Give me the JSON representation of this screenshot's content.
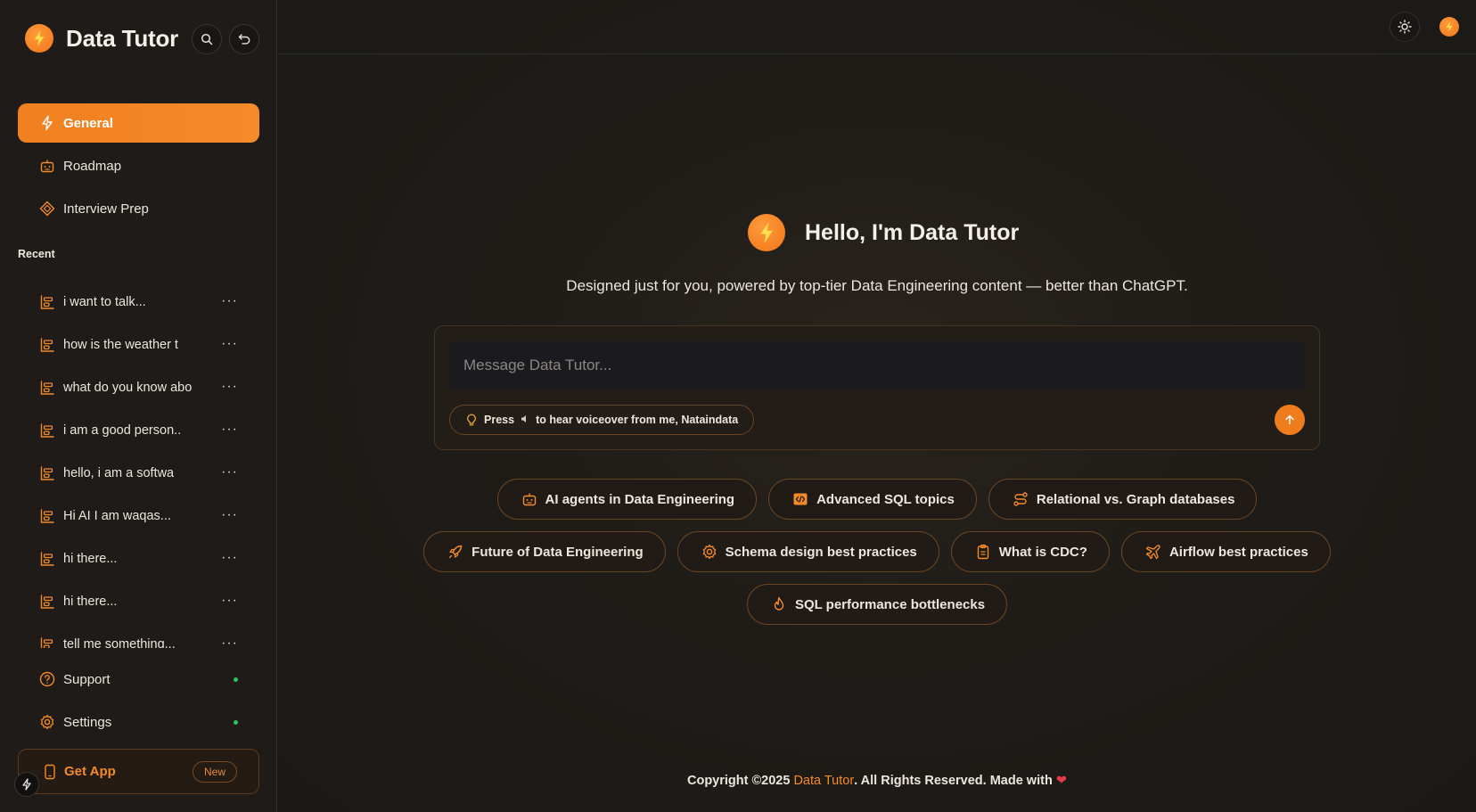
{
  "app": {
    "title": "Data Tutor"
  },
  "sidebar": {
    "nav": [
      {
        "label": "General",
        "icon": "zap-icon",
        "active": true
      },
      {
        "label": "Roadmap",
        "icon": "robot-icon",
        "active": false
      },
      {
        "label": "Interview Prep",
        "icon": "diamond-icon",
        "active": false
      }
    ],
    "recent_label": "Recent",
    "recent": [
      "i want to talk...",
      "how is the weather t",
      "what do you know abo",
      "i am a good person..",
      "hello, i am a softwa",
      "Hi AI I am waqas...",
      "hi there...",
      "hi there...",
      "tell me something..."
    ],
    "recent_menu": "···",
    "support_label": "Support",
    "settings_label": "Settings",
    "get_app_label": "Get App",
    "new_badge": "New"
  },
  "main": {
    "hero_title": "Hello, I'm Data Tutor",
    "subtitle": "Designed just for you, powered by top-tier Data Engineering content — better than ChatGPT.",
    "input_placeholder": "Message Data Tutor...",
    "hint_press": "Press",
    "hint_rest": "to hear voiceover from me, Nataindata",
    "chips_row1": [
      "AI agents in Data Engineering",
      "Advanced SQL topics",
      "Relational vs. Graph databases"
    ],
    "chips_row2": [
      "Future of Data Engineering",
      "Schema design best practices",
      "What is CDC?",
      "Airflow best practices"
    ],
    "chips_row3": [
      "SQL performance bottlenecks"
    ],
    "footer_prefix": "Copyright ©2025 ",
    "footer_brand": "Data Tutor",
    "footer_suffix": ". All Rights Reserved. Made with ",
    "footer_heart": "❤"
  },
  "colors": {
    "accent": "#f58a2a",
    "status_online": "#2fc45a"
  }
}
